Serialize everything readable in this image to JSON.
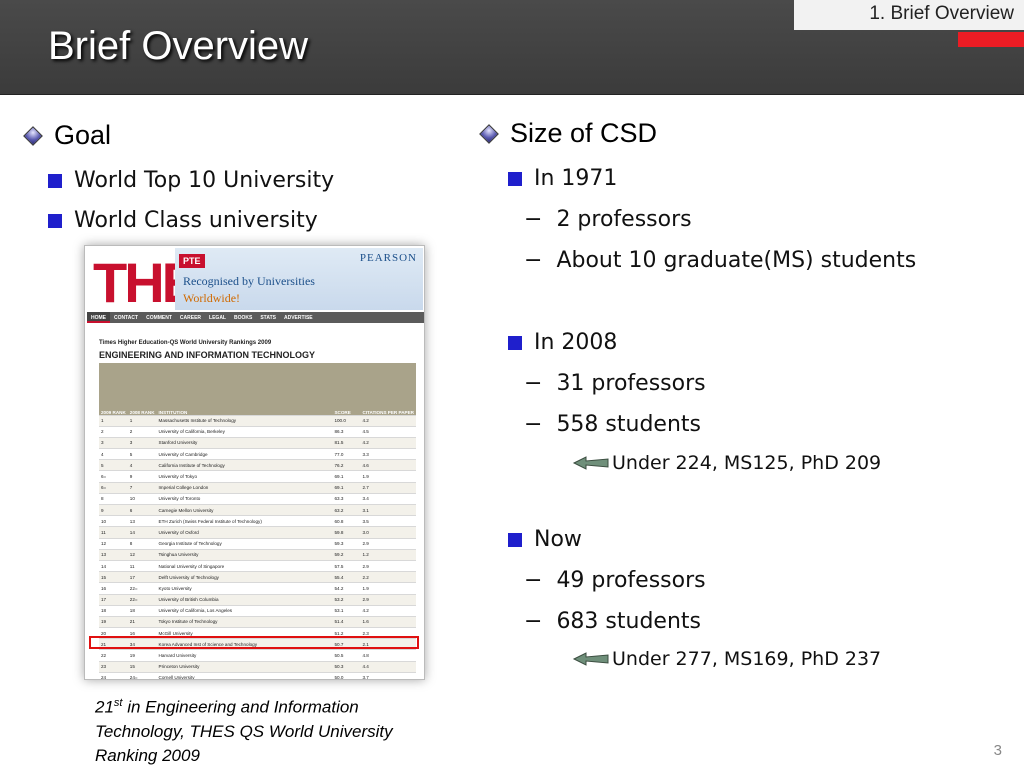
{
  "slide": {
    "title": "Brief Overview",
    "section_tag": "1. Brief Overview",
    "page_number": "3",
    "colors": {
      "header": "#3f3f3f",
      "accent": "#ec1c24",
      "bullet": "#1f1fcc"
    }
  },
  "left": {
    "heading": "Goal",
    "items": [
      "World Top 10 University",
      "World Class university"
    ],
    "caption": {
      "rank": "21",
      "rank_suffix": "st",
      "text": " in Engineering and Information Technology,  THES QS World University Ranking 2009"
    }
  },
  "ranking_image": {
    "logo": "THE",
    "pte": "PTE",
    "pearson": "PEARSON",
    "banner_line1": "Recognised by Universities",
    "banner_line2": "Worldwide!",
    "nav": [
      "HOME",
      "CONTACT",
      "COMMENT",
      "CAREER",
      "LEGAL",
      "BOOKS",
      "STATS",
      "ADVERTISE"
    ],
    "subtitle": "Times Higher Education-QS World University Rankings 2009",
    "heading": "ENGINEERING AND INFORMATION TECHNOLOGY",
    "columns": [
      "2009 RANK",
      "2008 RANK",
      "INSTITUTION",
      "SCORE",
      "CITATIONS PER PAPER"
    ],
    "rows": [
      [
        "1",
        "1",
        "Massachusetts Institute of Technology",
        "100.0",
        "4.2"
      ],
      [
        "2",
        "2",
        "University of California, Berkeley",
        "86.3",
        "4.5"
      ],
      [
        "3",
        "3",
        "Stanford University",
        "81.5",
        "4.2"
      ],
      [
        "4",
        "5",
        "University of Cambridge",
        "77.0",
        "3.3"
      ],
      [
        "5",
        "4",
        "California Institute of Technology",
        "76.2",
        "4.6"
      ],
      [
        "6=",
        "9",
        "University of Tokyo",
        "69.1",
        "1.9"
      ],
      [
        "6=",
        "7",
        "Imperial College London",
        "69.1",
        "2.7"
      ],
      [
        "8",
        "10",
        "University of Toronto",
        "63.3",
        "3.4"
      ],
      [
        "9",
        "6",
        "Carnegie Mellon University",
        "63.2",
        "3.1"
      ],
      [
        "10",
        "13",
        "ETH Zurich (Swiss Federal Institute of Technology)",
        "60.8",
        "3.5"
      ],
      [
        "11",
        "14",
        "University of Oxford",
        "59.8",
        "3.0"
      ],
      [
        "12",
        "8",
        "Georgia Institute of Technology",
        "59.3",
        "2.9"
      ],
      [
        "13",
        "12",
        "Tsinghua University",
        "59.2",
        "1.2"
      ],
      [
        "14",
        "11",
        "National University of Singapore",
        "57.5",
        "2.9"
      ],
      [
        "15",
        "17",
        "Delft University of Technology",
        "55.4",
        "2.2"
      ],
      [
        "16",
        "22=",
        "Kyoto University",
        "54.2",
        "1.9"
      ],
      [
        "17",
        "22=",
        "University of British Columbia",
        "53.2",
        "2.9"
      ],
      [
        "18",
        "18",
        "University of California, Los Angeles",
        "53.1",
        "4.2"
      ],
      [
        "19",
        "21",
        "Tokyo Institute of Technology",
        "51.4",
        "1.6"
      ],
      [
        "20",
        "16",
        "McGill University",
        "51.2",
        "2.3"
      ],
      [
        "21",
        "34",
        "Korea Advanced Inst of Science and Technology",
        "50.7",
        "2.1"
      ],
      [
        "22",
        "19",
        "Harvard University",
        "50.5",
        "4.8"
      ],
      [
        "23",
        "15",
        "Princeton University",
        "50.3",
        "4.4"
      ],
      [
        "24",
        "24=",
        "Cornell University",
        "50.0",
        "3.7"
      ]
    ]
  },
  "right": {
    "heading": "Size of CSD",
    "groups": [
      {
        "label": "In 1971",
        "items": [
          "2 professors",
          "About 10 graduate(MS) students"
        ],
        "detail": ""
      },
      {
        "label": "In 2008",
        "items": [
          "31 professors",
          "558 students"
        ],
        "detail": "Under 224, MS125, PhD 209"
      },
      {
        "label": "Now",
        "items": [
          "49 professors",
          "683 students"
        ],
        "detail": "Under 277, MS169, PhD 237"
      }
    ]
  }
}
